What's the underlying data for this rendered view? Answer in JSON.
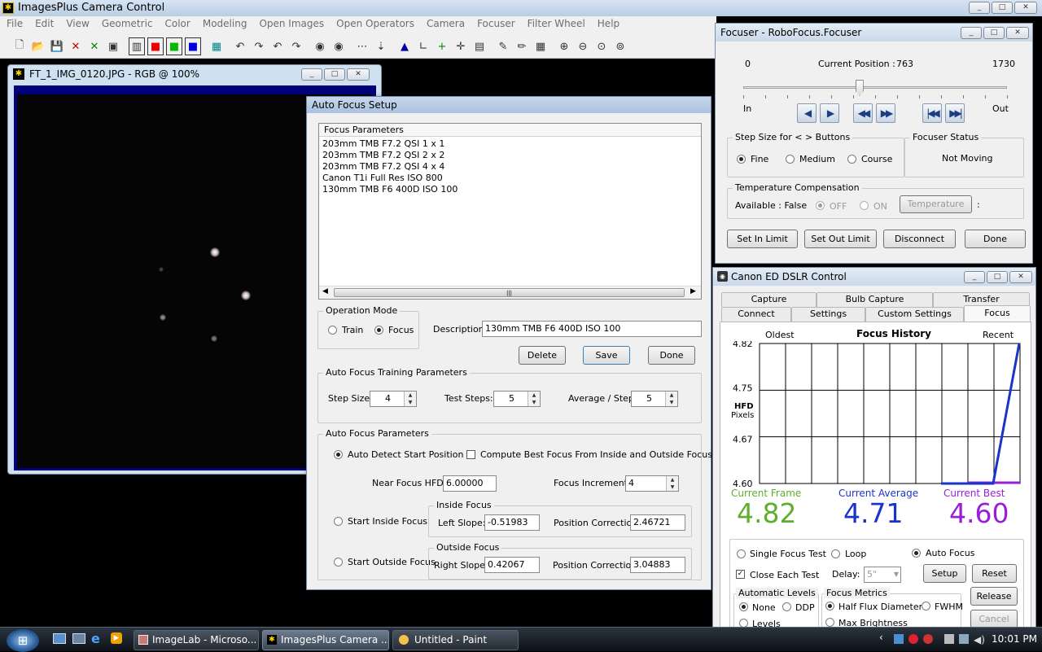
{
  "app": {
    "title": "ImagesPlus Camera Control",
    "menu": [
      "File",
      "Edit",
      "View",
      "Geometric",
      "Color",
      "Modeling",
      "Open Images",
      "Open Operators",
      "Camera",
      "Focuser",
      "Filter Wheel",
      "Help"
    ],
    "window_buttons": [
      "_",
      "□",
      "✕"
    ]
  },
  "toolbar": [
    "new-icon",
    "open-icon",
    "save-icon",
    "close-icon",
    "close-all-icon",
    "copy-icon",
    "rgb-icon",
    "red-icon",
    "green-icon",
    "blue-icon",
    "grid-icon",
    "undo-icon",
    "redo-icon",
    "undo2-icon",
    "redo2-icon",
    "target1-icon",
    "target2-icon",
    "dots-icon",
    "marker-icon",
    "histogram-icon",
    "curve-icon",
    "plus-icon",
    "crosshair-icon",
    "calc-icon",
    "tool-icon",
    "pencil-icon",
    "grid2-icon",
    "zoom-in-icon",
    "zoom-out-icon",
    "zoom-fit-icon",
    "zoom-actual-icon"
  ],
  "image_window": {
    "title": "FT_1_IMG_0120.JPG - RGB @ 100%"
  },
  "autofocus": {
    "title": "Auto Focus Setup",
    "params_header": "Focus Parameters",
    "params": [
      "203mm TMB F7.2 QSI 1 x 1",
      "203mm TMB F7.2 QSI 2 x 2",
      "203mm TMB F7.2 QSI 4 x 4",
      "Canon T1i Full Res ISO 800",
      "130mm TMB F6 400D ISO 100"
    ],
    "op_mode": "Operation Mode",
    "train": "Train",
    "focus": "Focus",
    "desc_label": "Description:",
    "desc_value": "130mm TMB F6 400D ISO 100",
    "delete": "Delete",
    "save": "Save",
    "done": "Done",
    "training": "Auto Focus Training Parameters",
    "step_size_label": "Step Size:",
    "step_size": "4",
    "test_steps_label": "Test Steps:",
    "test_steps": "5",
    "avg_label": "Average / Step:",
    "avg": "5",
    "af_params": "Auto Focus Parameters",
    "auto_detect": "Auto Detect Start Position",
    "compute_best": "Compute Best Focus From Inside and Outside Focus",
    "near_hfd_label": "Near Focus HFD:",
    "near_hfd": "6.00000",
    "increment_label": "Focus Increment:",
    "increment": "4",
    "start_inside": "Start Inside Focus",
    "inside_focus": "Inside Focus",
    "left_slope_label": "Left Slope:",
    "left_slope": "-0.51983",
    "pos_corr_label": "Position Correction:",
    "pos_corr_in": "2.46721",
    "start_outside": "Start Outside Focus",
    "outside_focus": "Outside Focus",
    "right_slope_label": "Right Slope:",
    "right_slope": "0.42067",
    "pos_corr_out": "3.04883"
  },
  "focuser": {
    "title": "Focuser - RoboFocus.Focuser",
    "min": "0",
    "max": "1730",
    "pos_label": "Current Position :",
    "position": "763",
    "position_value": 763,
    "in": "In",
    "out": "Out",
    "step_group": "Step Size for < > Buttons",
    "fine": "Fine",
    "medium": "Medium",
    "course": "Course",
    "status_group": "Focuser Status",
    "status": "Not Moving",
    "temp_group": "Temperature Compensation",
    "available": "Available : False",
    "off": "OFF",
    "on": "ON",
    "temp_btn": "Temperature",
    "colon": ":",
    "set_in": "Set In Limit",
    "set_out": "Set Out Limit",
    "disconnect": "Disconnect",
    "done": "Done"
  },
  "dslr": {
    "title": "Canon ED DSLR Control",
    "tabs_back": [
      "Capture",
      "Bulb Capture",
      "Transfer"
    ],
    "tabs_front": [
      "Connect",
      "Settings",
      "Custom Settings",
      "Focus"
    ],
    "oldest": "Oldest",
    "history": "Focus History",
    "recent": "Recent",
    "hfd": "HFD",
    "pixels": "Pixels",
    "yticks": [
      "4.82",
      "4.75",
      "4.67",
      "4.60"
    ],
    "cur_frame_label": "Current Frame",
    "cur_frame": "4.82",
    "cur_avg_label": "Current Average",
    "cur_avg": "4.71",
    "cur_best_label": "Current Best",
    "cur_best": "4.60",
    "single": "Single Focus Test",
    "loop": "Loop",
    "auto": "Auto Focus",
    "close_each": "Close Each Test",
    "delay_label": "Delay:",
    "delay": "5\"",
    "setup": "Setup",
    "reset": "Reset",
    "release": "Release",
    "cancel": "Cancel",
    "levels_group": "Automatic Levels",
    "none": "None",
    "ddp": "DDP",
    "levels": "Levels",
    "metrics_group": "Focus Metrics",
    "hfd_metric": "Half Flux Diameter",
    "fwhm": "FWHM",
    "maxb": "Max Brightness"
  },
  "chart_data": {
    "type": "line",
    "title": "Focus History",
    "ylabel": "HFD Pixels",
    "ylim": [
      4.6,
      4.82
    ],
    "series": [
      {
        "values": [
          4.6,
          4.6,
          4.6,
          4.82
        ]
      }
    ]
  },
  "taskbar": {
    "items": [
      "ImageLab - Microso...",
      "ImagesPlus Camera ...",
      "Untitled - Paint"
    ],
    "clock": "10:01 PM"
  }
}
